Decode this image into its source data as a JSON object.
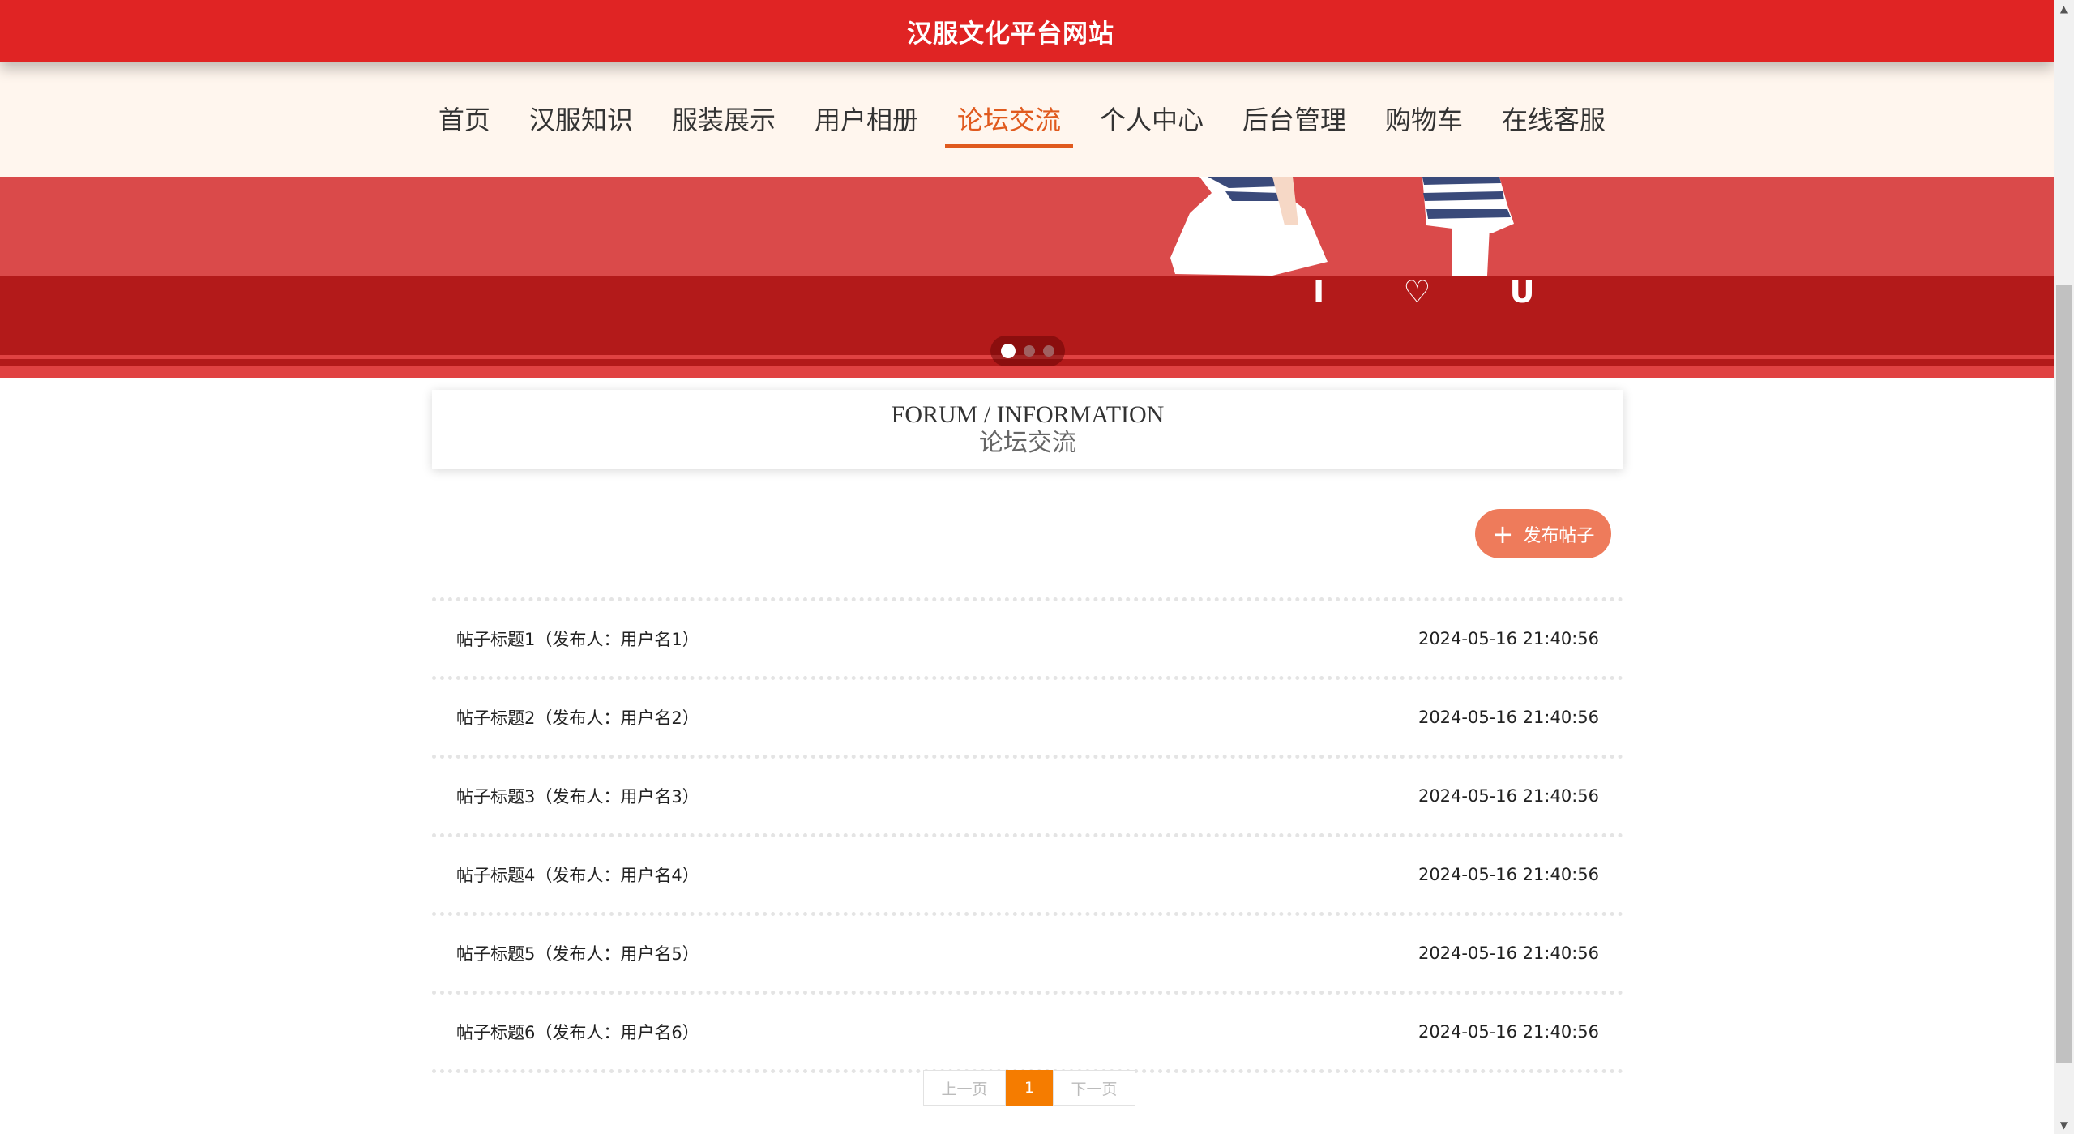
{
  "site": {
    "title": "汉服文化平台网站"
  },
  "nav": [
    {
      "label": "首页",
      "active": false
    },
    {
      "label": "汉服知识",
      "active": false
    },
    {
      "label": "服装展示",
      "active": false
    },
    {
      "label": "用户相册",
      "active": false
    },
    {
      "label": "论坛交流",
      "active": true
    },
    {
      "label": "个人中心",
      "active": false
    },
    {
      "label": "后台管理",
      "active": false
    },
    {
      "label": "购物车",
      "active": false
    },
    {
      "label": "在线客服",
      "active": false
    }
  ],
  "banner": {
    "caption": "I ♡ U",
    "slide_count": 3,
    "active_slide": 1
  },
  "forum": {
    "heading_en": "FORUM / INFORMATION",
    "heading_cn": "论坛交流",
    "post_button": "发布帖子",
    "posts": [
      {
        "title": "帖子标题1（发布人：用户名1）",
        "date": "2024-05-16 21:40:56"
      },
      {
        "title": "帖子标题2（发布人：用户名2）",
        "date": "2024-05-16 21:40:56"
      },
      {
        "title": "帖子标题3（发布人：用户名3）",
        "date": "2024-05-16 21:40:56"
      },
      {
        "title": "帖子标题4（发布人：用户名4）",
        "date": "2024-05-16 21:40:56"
      },
      {
        "title": "帖子标题5（发布人：用户名5）",
        "date": "2024-05-16 21:40:56"
      },
      {
        "title": "帖子标题6（发布人：用户名6）",
        "date": "2024-05-16 21:40:56"
      }
    ]
  },
  "pagination": {
    "prev": "上一页",
    "current": "1",
    "next": "下一页"
  },
  "colors": {
    "brand_red": "#e02424",
    "accent_orange": "#e05a1e",
    "post_button": "#ee7b5b",
    "page_current": "#f57c00"
  }
}
